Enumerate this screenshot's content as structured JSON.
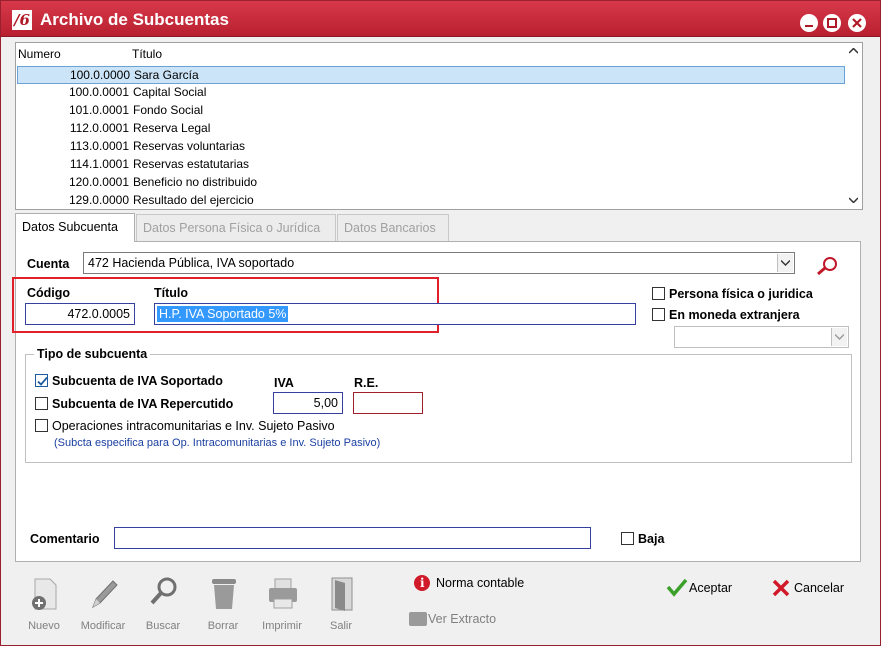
{
  "window": {
    "title": "Archivo de Subcuentas",
    "logo": "/6"
  },
  "list": {
    "columns": [
      "Numero",
      "Título"
    ],
    "rows": [
      {
        "num": "100.0.0000",
        "title": "Sara García"
      },
      {
        "num": "100.0.0001",
        "title": "Capital Social"
      },
      {
        "num": "101.0.0001",
        "title": "Fondo Social"
      },
      {
        "num": "112.0.0001",
        "title": "Reserva Legal"
      },
      {
        "num": "113.0.0001",
        "title": "Reservas voluntarias"
      },
      {
        "num": "114.1.0001",
        "title": "Reservas estatutarias"
      },
      {
        "num": "120.0.0001",
        "title": "Beneficio no distribuido"
      },
      {
        "num": "129.0.0000",
        "title": "Resultado del ejercicio"
      }
    ]
  },
  "tabs": [
    "Datos Subcuenta",
    "Datos Persona Física o Jurídica",
    "Datos Bancarios"
  ],
  "form": {
    "cuenta_label": "Cuenta",
    "cuenta_value": "472   Hacienda Pública, IVA soportado",
    "codigo_label": "Código",
    "codigo_value": "472.0.0005",
    "titulo_label": "Título",
    "titulo_value": "H.P. IVA Soportado 5%",
    "persona_label": "Persona física o juridica",
    "moneda_label": "En moneda extranjera",
    "group_title": "Tipo de subcuenta",
    "iva_soportado_label": "Subcuenta de IVA Soportado",
    "iva_soportado_checked": true,
    "iva_repercutido_label": "Subcuenta de IVA Repercutido",
    "iva_label": "IVA",
    "iva_value": "5,00",
    "re_label": "R.E.",
    "re_value": "",
    "intracom_label": "Operaciones intracomunitarias e Inv. Sujeto Pasivo",
    "intracom_note": "(Subcta especifica para Op. Intracomunitarias e Inv. Sujeto Pasivo)",
    "comentario_label": "Comentario",
    "comentario_value": "",
    "baja_label": "Baja"
  },
  "toolbar": {
    "nuevo": "Nuevo",
    "modificar": "Modificar",
    "buscar": "Buscar",
    "borrar": "Borrar",
    "imprimir": "Imprimir",
    "salir": "Salir"
  },
  "actions": {
    "norma_contable": "Norma contable",
    "ver_extracto": "Ver Extracto",
    "aceptar": "Aceptar",
    "cancelar": "Cancelar"
  },
  "colors": {
    "titlebar": "#c8283a",
    "accent_red": "#e0202a",
    "selection": "#cce4f7",
    "note_blue": "#1a3fa0"
  }
}
